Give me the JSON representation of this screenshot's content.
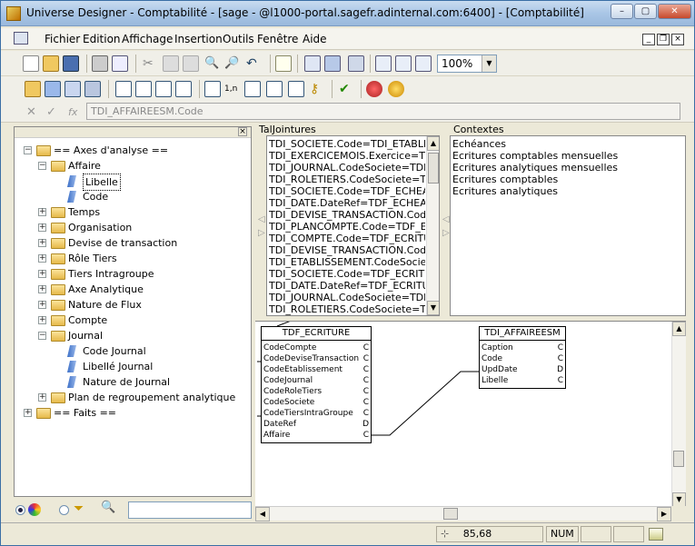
{
  "window": {
    "title": "Universe Designer - Comptabilité - [sage - @l1000-portal.sagefr.adinternal.com:6400] - [Comptabilité]"
  },
  "menu": [
    "Fichier",
    "Edition",
    "Affichage",
    "Insertion",
    "Outils",
    "Fenêtre",
    "Aide"
  ],
  "toolbar": {
    "zoom": "100%"
  },
  "formula": {
    "value": "TDI_AFFAIREESM.Code"
  },
  "tree": [
    {
      "label": "== Axes d'analyse ==",
      "level": 1,
      "type": "folder",
      "exp": "-"
    },
    {
      "label": "Affaire",
      "level": 2,
      "type": "folder",
      "exp": "-"
    },
    {
      "label": "Libelle",
      "level": 3,
      "type": "object",
      "selected": true
    },
    {
      "label": "Code",
      "level": 3,
      "type": "object"
    },
    {
      "label": "Temps",
      "level": 2,
      "type": "folder",
      "exp": "+"
    },
    {
      "label": "Organisation",
      "level": 2,
      "type": "folder",
      "exp": "+"
    },
    {
      "label": "Devise de transaction",
      "level": 2,
      "type": "folder",
      "exp": "+"
    },
    {
      "label": "Rôle Tiers",
      "level": 2,
      "type": "folder",
      "exp": "+"
    },
    {
      "label": "Tiers Intragroupe",
      "level": 2,
      "type": "folder",
      "exp": "+"
    },
    {
      "label": "Axe Analytique",
      "level": 2,
      "type": "folder",
      "exp": "+"
    },
    {
      "label": "Nature de Flux",
      "level": 2,
      "type": "folder",
      "exp": "+"
    },
    {
      "label": "Compte",
      "level": 2,
      "type": "folder",
      "exp": "+"
    },
    {
      "label": "Journal",
      "level": 2,
      "type": "folder",
      "exp": "-"
    },
    {
      "label": "Code Journal",
      "level": 3,
      "type": "object"
    },
    {
      "label": "Libellé Journal",
      "level": 3,
      "type": "object"
    },
    {
      "label": "Nature de Journal",
      "level": 3,
      "type": "object"
    },
    {
      "label": "Plan de regroupement analytique",
      "level": 2,
      "type": "folder",
      "exp": "+"
    },
    {
      "label": "== Faits ==",
      "level": 1,
      "type": "folder",
      "exp": "+"
    }
  ],
  "joins": {
    "header": "TalJointures",
    "items": [
      "TDI_SOCIETE.Code=TDI_ETABLISS",
      "TDI_EXERCICEMOIS.Exercice=TDI_",
      "TDI_JOURNAL.CodeSociete=TDF_E",
      "TDI_ROLETIERS.CodeSociete=TDF",
      "TDI_SOCIETE.Code=TDF_ECHEANC",
      "TDI_DATE.DateRef=TDF_ECHEANC",
      "TDI_DEVISE_TRANSACTION.Code=",
      "TDI_PLANCOMPTE.Code=TDF_ECR",
      "TDI_COMPTE.Code=TDF_ECRITUR",
      "TDI_DEVISE_TRANSACTION.Code=",
      "TDI_ETABLISSEMENT.CodeSociete",
      "TDI_SOCIETE.Code=TDF_ECRITUR",
      "TDI_DATE.DateRef=TDF_ECRITUR",
      "TDI_JOURNAL.CodeSociete=TDF_E",
      "TDI_ROLETIERS.CodeSociete=TDF"
    ]
  },
  "contexts": {
    "header": "Contextes",
    "items": [
      "Echéances",
      "Ecritures comptables mensuelles",
      "Ecritures analytiques mensuelles",
      "Ecritures comptables",
      "Ecritures analytiques"
    ]
  },
  "tables": [
    {
      "name": "TDF_ECRITURE",
      "columns": [
        {
          "n": "CodeCompte",
          "t": "C"
        },
        {
          "n": "CodeDeviseTransaction",
          "t": "C"
        },
        {
          "n": "CodeEtablissement",
          "t": "C"
        },
        {
          "n": "CodeJournal",
          "t": "C"
        },
        {
          "n": "CodeRoleTiers",
          "t": "C"
        },
        {
          "n": "CodeSociete",
          "t": "C"
        },
        {
          "n": "CodeTiersIntraGroupe",
          "t": "C"
        },
        {
          "n": "DateRef",
          "t": "D"
        },
        {
          "n": "Affaire",
          "t": "C"
        }
      ]
    },
    {
      "name": "TDI_AFFAIREESM",
      "columns": [
        {
          "n": "Caption",
          "t": "C"
        },
        {
          "n": "Code",
          "t": "C"
        },
        {
          "n": "UpdDate",
          "t": "D"
        },
        {
          "n": "Libelle",
          "t": "C"
        }
      ]
    }
  ],
  "status": {
    "coords": "85,68",
    "num": "NUM"
  }
}
